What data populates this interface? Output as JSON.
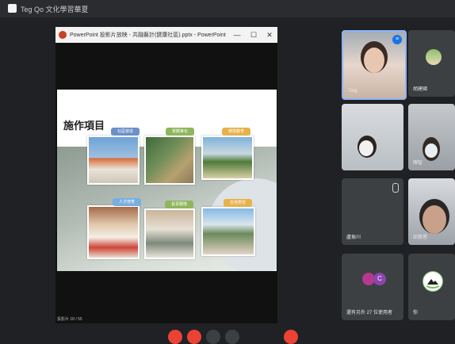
{
  "window": {
    "title": "Teg Qo 文化學習華夏"
  },
  "powerpoint": {
    "title": "PowerPoint 投影片放映 - 共融藝計(健康社區).pptx - PowerPoint",
    "controls": {
      "minimize": "—",
      "maximize": "☐",
      "close": "✕"
    },
    "status": "投影片 18 / 55"
  },
  "slide": {
    "heading": "施作項目",
    "tags": [
      "社區營造",
      "景觀美化",
      "環境教育",
      "人才培育",
      "長青關懷",
      "在地學習"
    ]
  },
  "participants": [
    {
      "name": "Ting",
      "mic": "mic-active-icon"
    },
    {
      "name": "胡建國"
    },
    {
      "name": ""
    },
    {
      "name": "陳智"
    },
    {
      "name": "盧振川"
    },
    {
      "name": "邱慈恩"
    },
    {
      "name": "還有另外 27 位使用者"
    },
    {
      "name": "你"
    }
  ],
  "avatars": [
    {
      "letter": ""
    },
    {
      "letter": "C"
    }
  ],
  "colors": {
    "accent": "#8ab4f8",
    "danger": "#ea4335",
    "tile": "#3c4043"
  }
}
